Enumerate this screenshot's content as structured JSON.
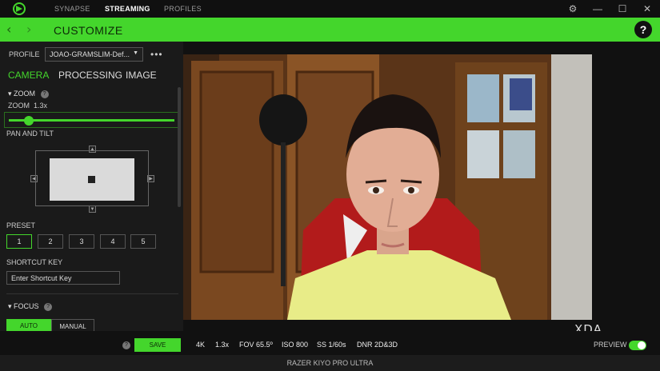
{
  "topbar": {
    "tabs": [
      {
        "label": "SYNAPSE"
      },
      {
        "label": "STREAMING"
      },
      {
        "label": "PROFILES"
      }
    ],
    "brand_color": "#44d62c"
  },
  "header": {
    "title": "CUSTOMIZE",
    "help": "?"
  },
  "profile": {
    "label": "PROFILE",
    "value": "JOAO-GRAMSLIM-Def...",
    "more": "•••"
  },
  "subtabs": [
    {
      "label": "CAMERA"
    },
    {
      "label": "PROCESSING"
    },
    {
      "label": "IMAGE"
    }
  ],
  "zoom": {
    "heading": "ZOOM",
    "label": "ZOOM",
    "value": "1.3x",
    "level_fraction": 0.12
  },
  "pan_tilt": {
    "label": "PAN AND TILT"
  },
  "preset": {
    "label": "PRESET",
    "buttons": [
      "1",
      "2",
      "3",
      "4",
      "5"
    ],
    "selected": "1"
  },
  "shortcut": {
    "label": "SHORTCUT KEY",
    "value": "Enter Shortcut Key"
  },
  "focus": {
    "heading": "FOCUS",
    "options": [
      "AUTO",
      "MANUAL"
    ],
    "selected": "AUTO"
  },
  "footer": {
    "save": "SAVE",
    "help": "?",
    "stats": [
      "4K",
      "1.3x",
      "FOV 65.5º",
      "ISO 800",
      "SS 1/60s",
      "DNR 2D&3D"
    ],
    "preview_label": "PREVIEW",
    "preview_on": true,
    "device": "RAZER KIYO PRO ULTRA"
  },
  "watermark": "XDA"
}
